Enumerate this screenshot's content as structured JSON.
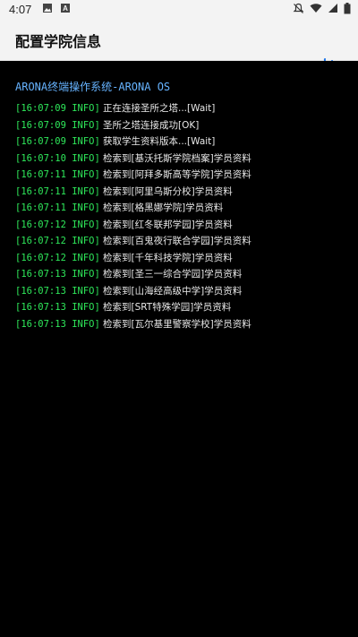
{
  "status_bar": {
    "time": "4:07",
    "icons": [
      "image-icon",
      "a-icon"
    ],
    "right_icons": [
      "notifications-off-icon",
      "wifi-icon",
      "signal-icon",
      "battery-icon"
    ]
  },
  "app_bar": {
    "title": "配置学院信息"
  },
  "terminal": {
    "header": "ARONA终端操作系统-ARONA OS",
    "colors": {
      "timestamp": "#2ee85a",
      "header": "#66b3ff",
      "text": "#e8e8e8"
    },
    "lines": [
      {
        "time": "[16:07:09 INFO]",
        "text": "正在连接圣所之塔...[Wait]"
      },
      {
        "time": "[16:07:09 INFO]",
        "text": "圣所之塔连接成功[OK]"
      },
      {
        "time": "[16:07:09 INFO]",
        "text": "获取学生资料版本...[Wait]"
      },
      {
        "time": "[16:07:10 INFO]",
        "text": "检索到[基沃托斯学院档案]学员资料"
      },
      {
        "time": "[16:07:11 INFO]",
        "text": "检索到[阿拜多斯高等学院]学员资料"
      },
      {
        "time": "[16:07:11 INFO]",
        "text": "检索到[阿里乌斯分校]学员资料"
      },
      {
        "time": "[16:07:11 INFO]",
        "text": "检索到[格黑娜学院]学员资料"
      },
      {
        "time": "[16:07:12 INFO]",
        "text": "检索到[红冬联邦学园]学员资料"
      },
      {
        "time": "[16:07:12 INFO]",
        "text": "检索到[百鬼夜行联合学园]学员资料"
      },
      {
        "time": "[16:07:12 INFO]",
        "text": "检索到[千年科技学院]学员资料"
      },
      {
        "time": "[16:07:13 INFO]",
        "text": "检索到[圣三一综合学园]学员资料"
      },
      {
        "time": "[16:07:13 INFO]",
        "text": "检索到[山海经高级中学]学员资料"
      },
      {
        "time": "[16:07:13 INFO]",
        "text": "检索到[SRT特殊学园]学员资料"
      },
      {
        "time": "[16:07:13 INFO]",
        "text": "检索到[瓦尔基里警察学校]学员资料"
      }
    ]
  }
}
